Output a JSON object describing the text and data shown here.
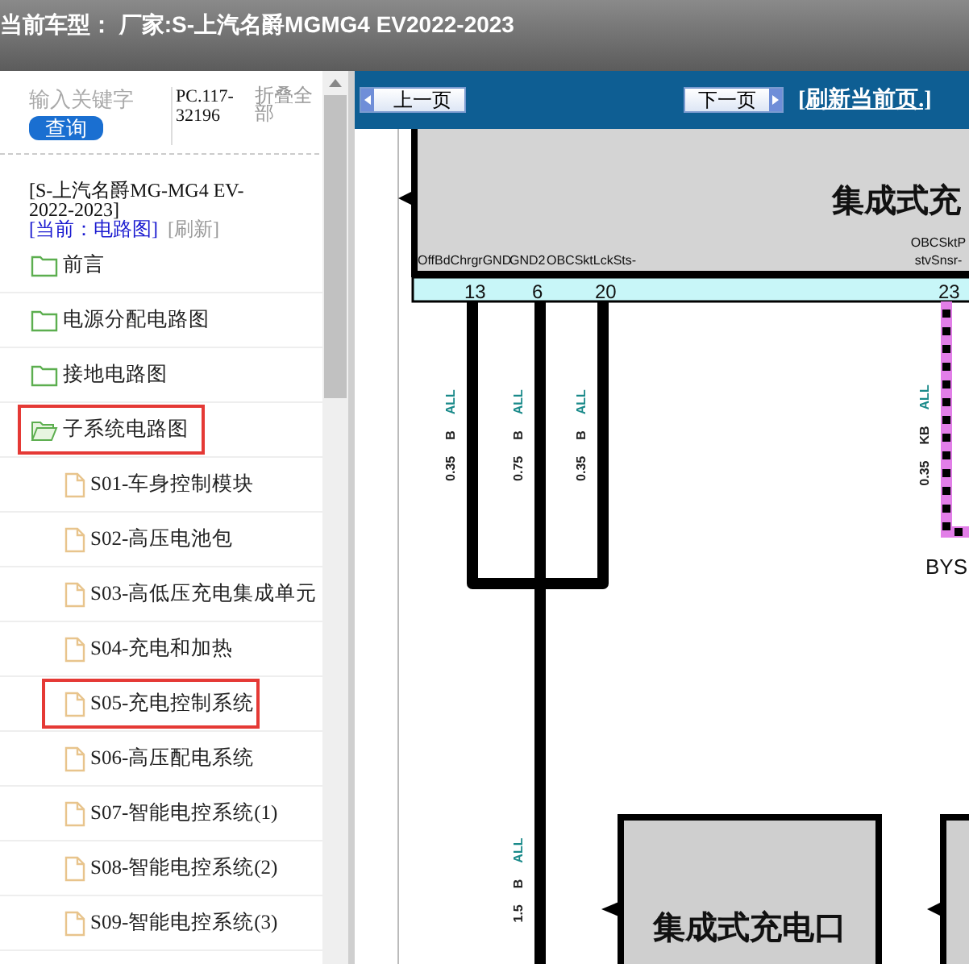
{
  "header": {
    "title": "当前车型：  厂家:S-上汽名爵MGMG4 EV2022-2023"
  },
  "sidebar": {
    "search": {
      "placeholder": "输入关键字",
      "button": "查询"
    },
    "code": "PC.117-32196",
    "collapse_all": "折叠全部",
    "vehicle": "[S-上汽名爵MG-MG4 EV-2022-2023]",
    "current": "[当前：电路图]",
    "refresh": "[刷新]",
    "tree": [
      {
        "label": "前言",
        "expanded": false,
        "highlighted": false
      },
      {
        "label": "电源分配电路图",
        "expanded": false,
        "highlighted": false
      },
      {
        "label": "接地电路图",
        "expanded": false,
        "highlighted": false
      },
      {
        "label": "子系统电路图",
        "expanded": true,
        "highlighted": true,
        "children": [
          {
            "label": "S01-车身控制模块",
            "highlighted": false
          },
          {
            "label": "S02-高压电池包",
            "highlighted": false
          },
          {
            "label": "S03-高低压充电集成单元",
            "highlighted": false
          },
          {
            "label": "S04-充电和加热",
            "highlighted": false
          },
          {
            "label": "S05-充电控制系统",
            "highlighted": true
          },
          {
            "label": "S06-高压配电系统",
            "highlighted": false
          },
          {
            "label": "S07-智能电控系统(1)",
            "highlighted": false
          },
          {
            "label": "S08-智能电控系统(2)",
            "highlighted": false
          },
          {
            "label": "S09-智能电控系统(3)",
            "highlighted": false
          }
        ]
      }
    ]
  },
  "toolbar": {
    "prev": "上一页",
    "next": "下一页",
    "refresh": "[刷新当前页.]"
  },
  "diagram": {
    "top_component": {
      "title": "集成式充",
      "pin_labels": [
        "OffBdChrgrGND",
        "GND2",
        "OBCSktLckSts-",
        "OBCSktP",
        "stvSnsr-"
      ]
    },
    "pins": [
      {
        "number": "13",
        "size": "0.35",
        "wire_color": "B",
        "option": "ALL",
        "kind": "solid"
      },
      {
        "number": "6",
        "size": "0.75",
        "wire_color": "B",
        "option": "ALL",
        "kind": "solid"
      },
      {
        "number": "20",
        "size": "0.35",
        "wire_color": "B",
        "option": "ALL",
        "kind": "solid"
      },
      {
        "number": "23",
        "size": "0.35",
        "wire_color": "KB",
        "option": "ALL",
        "kind": "dashed"
      }
    ],
    "ground_wire": {
      "size": "1.5",
      "wire_color": "B",
      "option": "ALL"
    },
    "wire_end_label": "BYS",
    "bottom_component": {
      "title": "集成式充电口"
    }
  }
}
